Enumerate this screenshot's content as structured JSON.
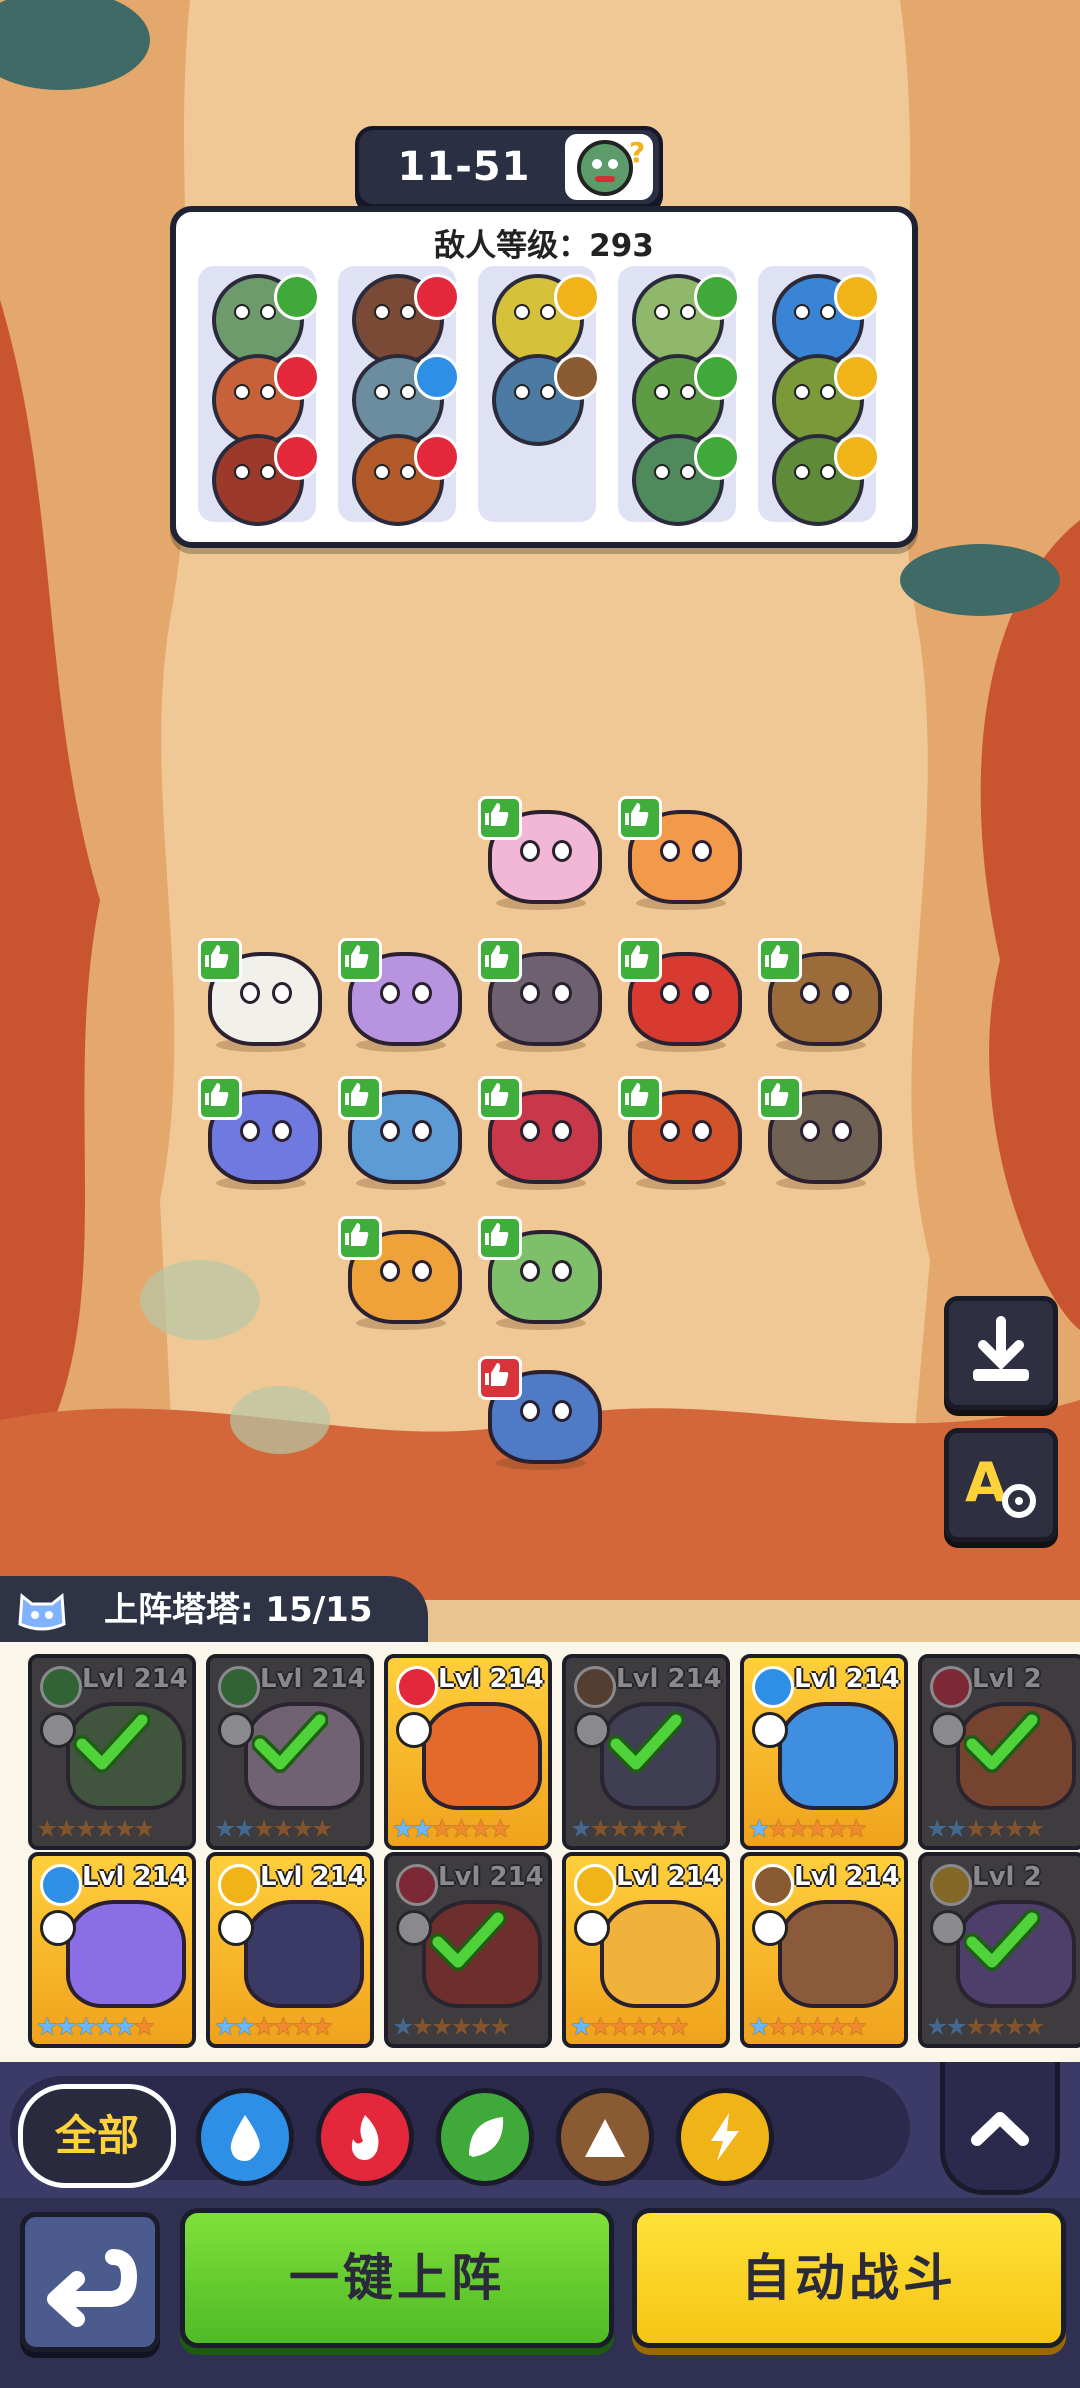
{
  "stage": {
    "level": "11-51"
  },
  "enemy_panel": {
    "title": "敌人等级：293",
    "columns": [
      {
        "enemies": [
          {
            "element": "grass",
            "color": "#6e9b6b"
          },
          {
            "element": "fire",
            "color": "#c7613a"
          },
          {
            "element": "fire",
            "color": "#9b3a2a"
          }
        ]
      },
      {
        "enemies": [
          {
            "element": "fire",
            "color": "#7a4a36"
          },
          {
            "element": "water",
            "color": "#6c8ca0"
          },
          {
            "element": "fire",
            "color": "#b25a2a"
          }
        ]
      },
      {
        "enemies": [
          {
            "element": "thunder",
            "color": "#d6c23a"
          },
          {
            "element": "earth",
            "color": "#4b7aa3"
          }
        ]
      },
      {
        "enemies": [
          {
            "element": "grass",
            "color": "#8fb86a"
          },
          {
            "element": "grass",
            "color": "#5e9b45"
          },
          {
            "element": "grass",
            "color": "#4e8a5b"
          }
        ]
      },
      {
        "enemies": [
          {
            "element": "thunder",
            "color": "#3a84d6"
          },
          {
            "element": "thunder",
            "color": "#7a9a3a"
          },
          {
            "element": "thunder",
            "color": "#5e8a3a"
          }
        ]
      }
    ]
  },
  "board_units": [
    {
      "name": "pink-mantis",
      "color": "#f3b7d6",
      "recommended": true
    },
    {
      "name": "fire-bunny",
      "color": "#f39a4a",
      "recommended": true
    },
    {
      "name": "white-bear",
      "color": "#f2f0ea",
      "recommended": true
    },
    {
      "name": "purple-cat",
      "color": "#b793e0",
      "recommended": true
    },
    {
      "name": "raccoon",
      "color": "#6d6170",
      "recommended": true
    },
    {
      "name": "red-lizard",
      "color": "#d93a2f",
      "recommended": true
    },
    {
      "name": "rock-turtle",
      "color": "#9b6b3a",
      "recommended": true
    },
    {
      "name": "blue-chameleon",
      "color": "#6f79e0",
      "recommended": true
    },
    {
      "name": "water-otter",
      "color": "#5d9bd6",
      "recommended": true
    },
    {
      "name": "plant-bulb",
      "color": "#c8384a",
      "recommended": true
    },
    {
      "name": "fire-wolf",
      "color": "#d2522a",
      "recommended": true
    },
    {
      "name": "stone-dragon",
      "color": "#6f6253",
      "recommended": true
    },
    {
      "name": "fox-deer",
      "color": "#f0a23a",
      "recommended": true
    },
    {
      "name": "green-dino",
      "color": "#7ec06a",
      "recommended": true
    },
    {
      "name": "blue-monkey",
      "color": "#4f7ac6",
      "recommended": false
    }
  ],
  "side_buttons": {
    "save_icon": "download-icon",
    "auto_settings_icon": "auto-settings-icon"
  },
  "team": {
    "label": "上阵塔塔: 15/15"
  },
  "roster": {
    "cards": [
      {
        "level": "Lvl 214",
        "element": "grass",
        "deployed": true,
        "art": "#5f8a4e",
        "blue_stars": 0
      },
      {
        "level": "Lvl 214",
        "element": "grass",
        "deployed": true,
        "art": "#c7a6c3",
        "blue_stars": 2
      },
      {
        "level": "Lvl 214",
        "element": "fire",
        "deployed": false,
        "art": "#e36a2a",
        "blue_stars": 2
      },
      {
        "level": "Lvl 214",
        "element": "earth",
        "deployed": true,
        "art": "#5e5a7a",
        "blue_stars": 1
      },
      {
        "level": "Lvl 214",
        "element": "water",
        "deployed": false,
        "art": "#3f8ee0",
        "blue_stars": 1
      },
      {
        "level": "Lvl 2",
        "element": "fire",
        "deployed": true,
        "art": "#d4662a",
        "blue_stars": 2
      },
      {
        "level": "Lvl 214",
        "element": "water",
        "deployed": false,
        "art": "#8a6ee6",
        "blue_stars": 5
      },
      {
        "level": "Lvl 214",
        "element": "thunder",
        "deployed": false,
        "art": "#3b3a66",
        "blue_stars": 2
      },
      {
        "level": "Lvl 214",
        "element": "fire",
        "deployed": true,
        "art": "#c4352a",
        "blue_stars": 1
      },
      {
        "level": "Lvl 214",
        "element": "thunder",
        "deployed": false,
        "art": "#f0b23a",
        "blue_stars": 1
      },
      {
        "level": "Lvl 214",
        "element": "earth",
        "deployed": false,
        "art": "#8a5a3a",
        "blue_stars": 1
      },
      {
        "level": "Lvl 2",
        "element": "thunder",
        "deployed": true,
        "art": "#7a5ab0",
        "blue_stars": 2
      }
    ]
  },
  "filters": {
    "all_label": "全部",
    "elements": [
      {
        "icon": "water-drop-icon",
        "color": "#2e8fe6"
      },
      {
        "icon": "fire-icon",
        "color": "#e2283a"
      },
      {
        "icon": "leaf-icon",
        "color": "#3faa3a"
      },
      {
        "icon": "mountain-icon",
        "color": "#8a5a32"
      },
      {
        "icon": "lightning-icon",
        "color": "#f0b419"
      }
    ]
  },
  "actions": {
    "one_click_deploy": "一键上阵",
    "auto_battle": "自动战斗"
  }
}
